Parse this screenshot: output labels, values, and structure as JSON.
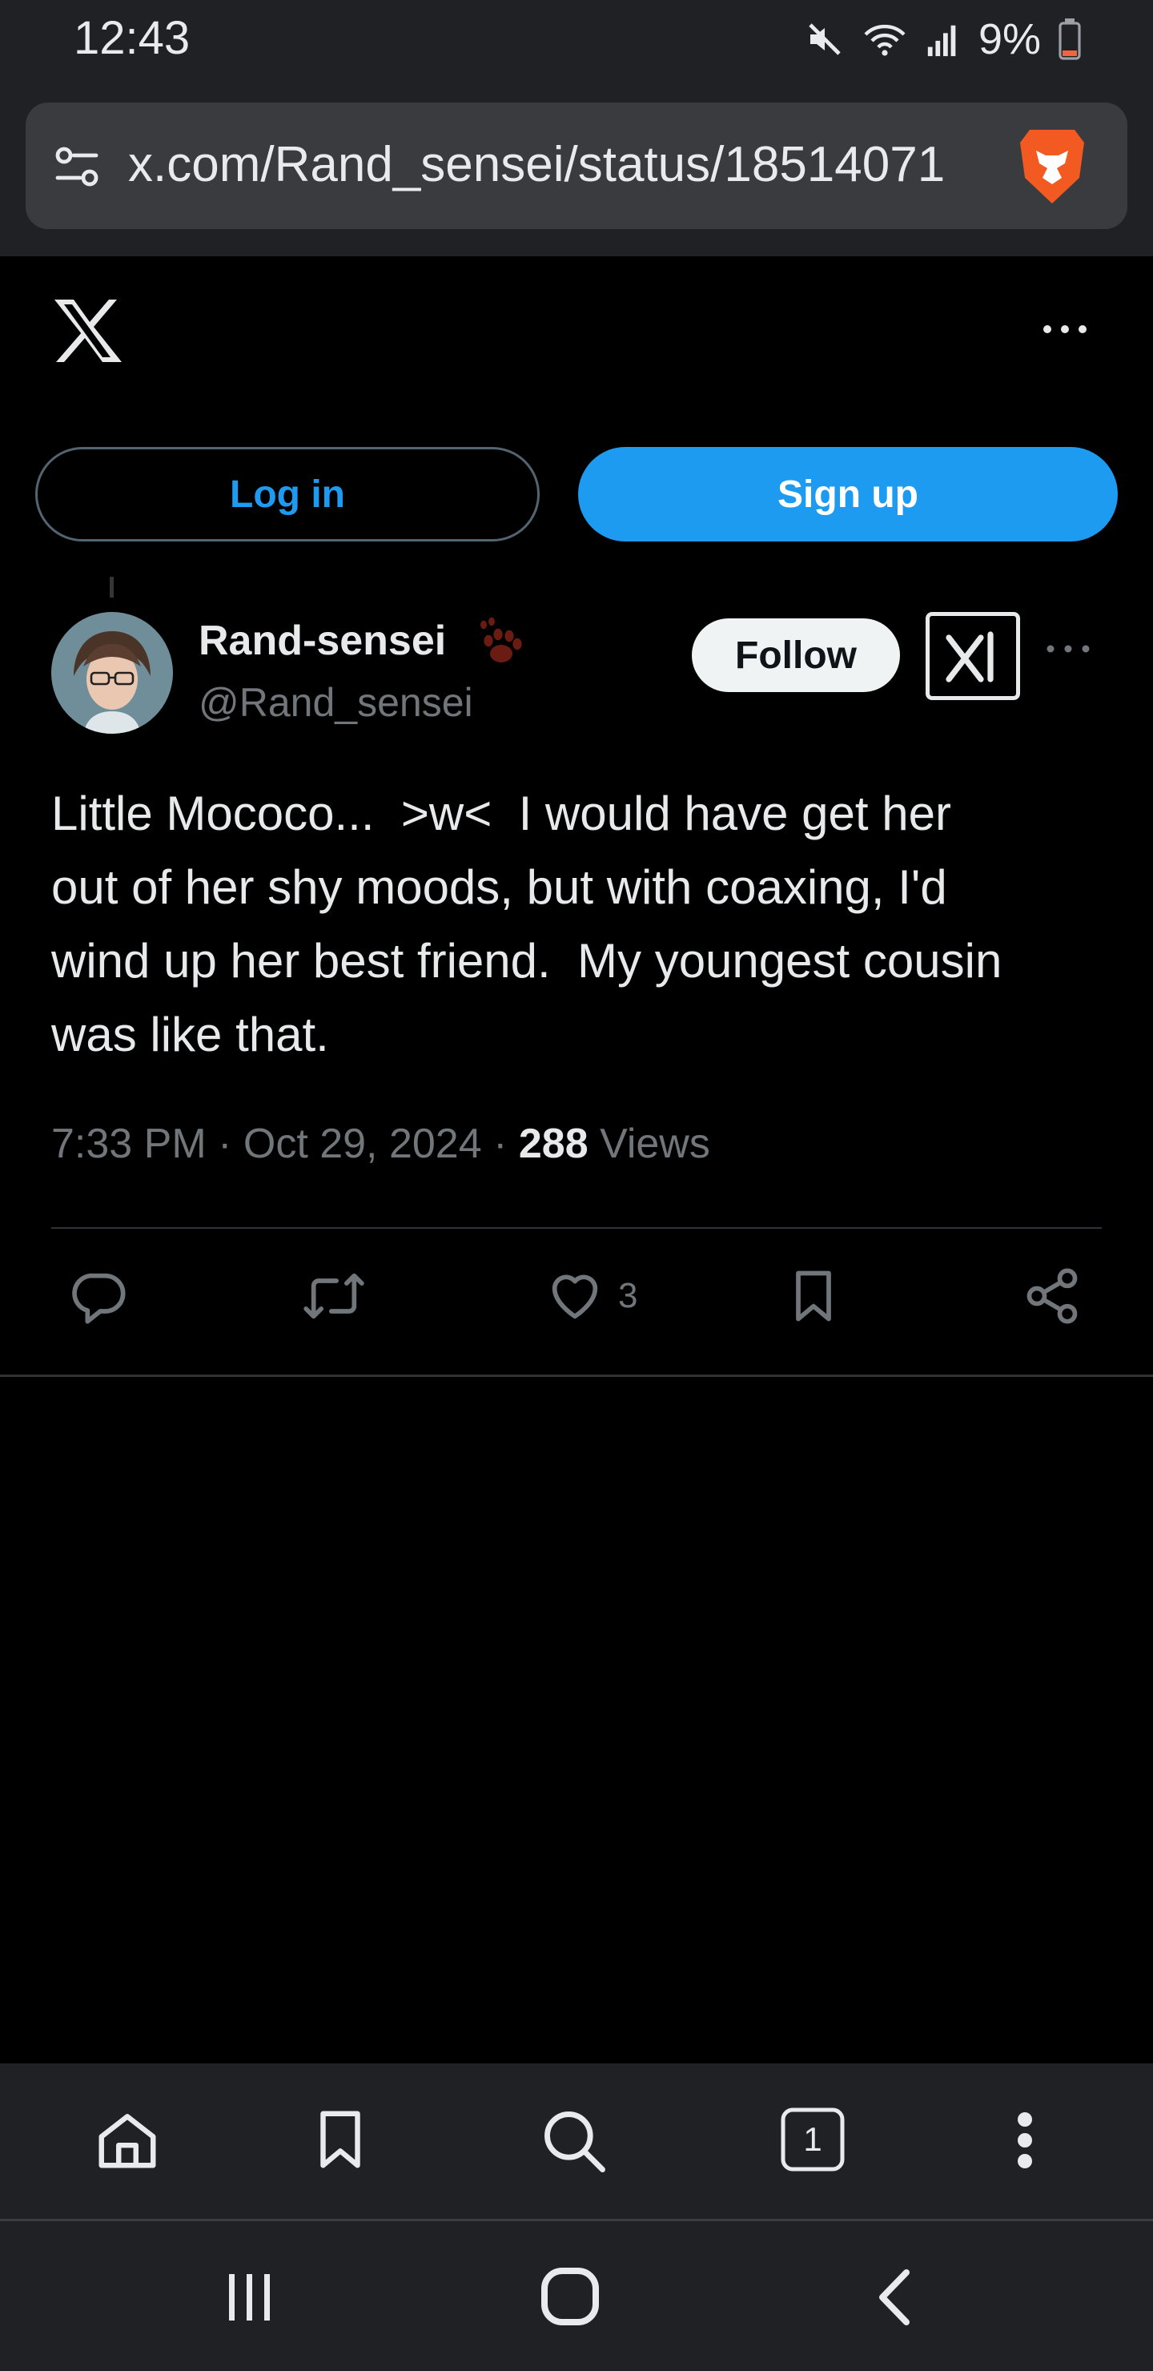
{
  "status_bar": {
    "time": "12:43",
    "battery": "9%"
  },
  "browser": {
    "url": "x.com/Rand_sensei/status/18514071"
  },
  "header": {
    "login_label": "Log in",
    "signup_label": "Sign up"
  },
  "tweet": {
    "display_name": "Rand-sensei",
    "handle": "@Rand_sensei",
    "follow_label": "Follow",
    "text": "Little Mococo...  >w<  I would have get her\nout of her shy moods, but with coaxing, I'd\nwind up her best friend.  My youngest cousin\nwas like that.",
    "time": "7:33 PM",
    "date": "Oct 29, 2024",
    "views_count": "288",
    "views_label": "Views",
    "like_count": "3"
  },
  "toolbar": {
    "tab_count": "1"
  },
  "icons": {
    "brand": "brave-lion-icon",
    "accent": "#1d9bf0",
    "text_primary": "#e7e9ea",
    "text_secondary": "#71767b"
  }
}
